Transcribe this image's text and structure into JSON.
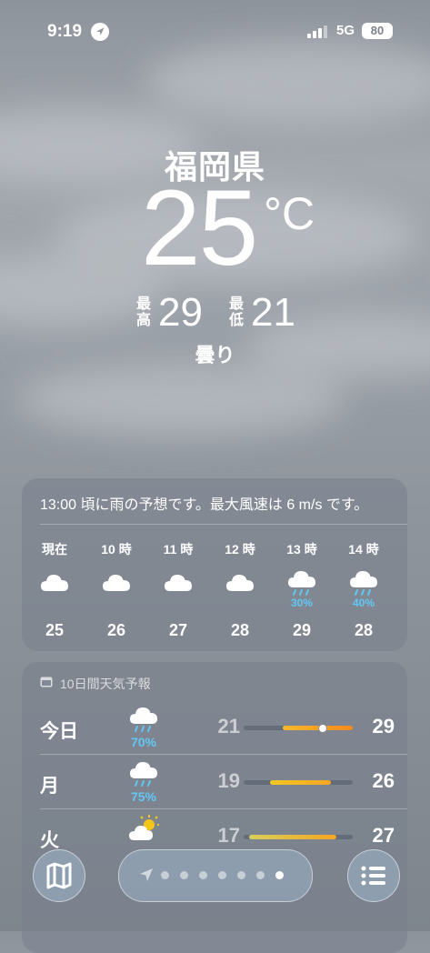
{
  "status_bar": {
    "time": "9:19",
    "network": "5G",
    "battery": "80"
  },
  "location": {
    "name": "福岡県",
    "temperature": "25",
    "unit": "°C",
    "high_label": "最高",
    "high": "29",
    "low_label": "最低",
    "low": "21",
    "condition": "曇り"
  },
  "hourly": {
    "summary": "13:00 頃に雨の予想です。最大風速は 6 m/s です。",
    "items": [
      {
        "label": "現在",
        "icon": "cloud-icon",
        "precip": "",
        "temp": "25"
      },
      {
        "label": "10 時",
        "icon": "cloud-icon",
        "precip": "",
        "temp": "26"
      },
      {
        "label": "11 時",
        "icon": "cloud-icon",
        "precip": "",
        "temp": "27"
      },
      {
        "label": "12 時",
        "icon": "cloud-icon",
        "precip": "",
        "temp": "28"
      },
      {
        "label": "13 時",
        "icon": "cloud-rain-icon",
        "precip": "30%",
        "temp": "29"
      },
      {
        "label": "14 時",
        "icon": "cloud-rain-icon",
        "precip": "40%",
        "temp": "28"
      }
    ]
  },
  "daily": {
    "header": "10日間天気予報",
    "days": [
      {
        "day": "今日",
        "icon": "cloud-rain-icon",
        "precip": "70%",
        "low": "21",
        "high": "29",
        "bar_start": 0.36,
        "bar_end": 1.0,
        "current_marker": 0.72,
        "bar_color": "linear-gradient(90deg,#f6b92b,#f5891d)"
      },
      {
        "day": "月",
        "icon": "cloud-rain-icon",
        "precip": "75%",
        "low": "19",
        "high": "26",
        "bar_start": 0.24,
        "bar_end": 0.8,
        "current_marker": null,
        "bar_color": "linear-gradient(90deg,#f3c623,#f5a623)"
      },
      {
        "day": "火",
        "icon": "partly-sunny-icon",
        "precip": "",
        "low": "17",
        "high": "27",
        "bar_start": 0.05,
        "bar_end": 0.85,
        "current_marker": null,
        "bar_color": "linear-gradient(90deg,#d7cf5a,#f5a623)"
      }
    ]
  },
  "controls": {
    "page_count": 7,
    "active_page": 7
  },
  "colors": {
    "precip": "#62c7f5"
  }
}
